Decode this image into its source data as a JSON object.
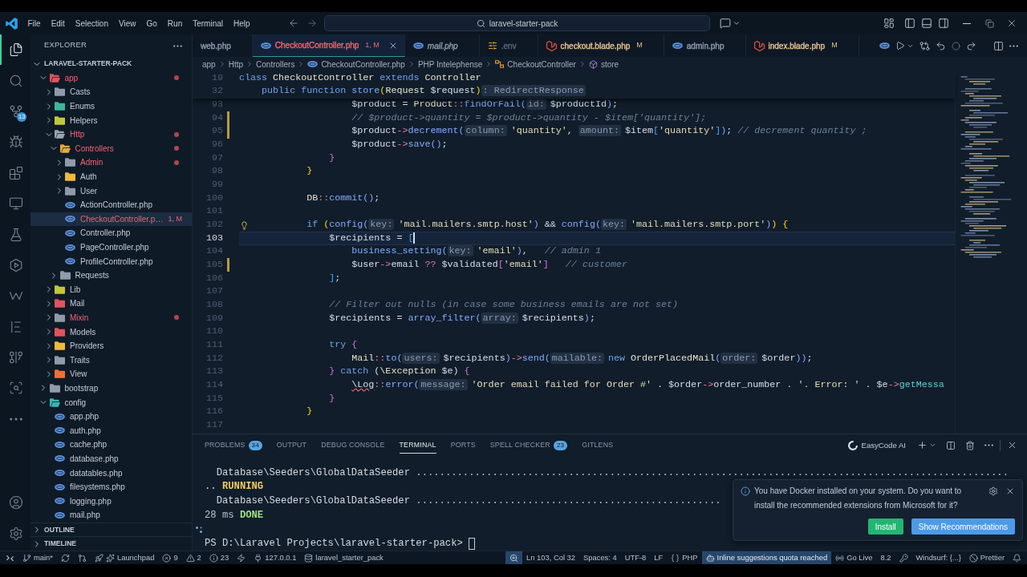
{
  "title_bar": {
    "menu": [
      "File",
      "Edit",
      "Selection",
      "View",
      "Go",
      "Run",
      "Terminal",
      "Help"
    ],
    "command_center": "laravel-starter-pack"
  },
  "activity_bar": {
    "items": [
      {
        "kind": "explorer",
        "selected": true
      },
      {
        "kind": "search",
        "selected": false
      },
      {
        "kind": "source_control",
        "selected": false,
        "badge": "13"
      },
      {
        "kind": "run_debug",
        "selected": false
      },
      {
        "kind": "extensions",
        "selected": false
      },
      {
        "kind": "remote",
        "selected": false
      },
      {
        "kind": "testing",
        "selected": false
      },
      {
        "kind": "hexagon",
        "selected": false
      },
      {
        "kind": "zigzag",
        "selected": false
      },
      {
        "kind": "bar_lines",
        "selected": false
      },
      {
        "kind": "git_graph",
        "selected": false
      },
      {
        "kind": "git_search",
        "selected": false
      },
      {
        "kind": "more",
        "selected": false
      }
    ],
    "bottom_items": [
      {
        "kind": "account"
      },
      {
        "kind": "settings"
      }
    ]
  },
  "sidebar": {
    "title": "EXPLORER",
    "sections": [
      {
        "title": "LARAVEL-STARTER-PACK",
        "expanded": true,
        "tree": [
          {
            "name": "app",
            "kind": "folder",
            "color": "#e0545c",
            "expanded": true,
            "selected": false,
            "problems": true,
            "children": [
              {
                "name": "Casts",
                "kind": "folder",
                "color": "#8f9bab",
                "expanded": false,
                "selected": false,
                "problems": false
              },
              {
                "name": "Enums",
                "kind": "folder",
                "color": "#3bb59c",
                "expanded": false,
                "selected": false,
                "problems": false
              },
              {
                "name": "Helpers",
                "kind": "folder",
                "color": "#c2c83c",
                "expanded": false,
                "selected": false,
                "problems": false
              },
              {
                "name": "Http",
                "kind": "folder",
                "color": "#9aa5b2",
                "expanded": true,
                "selected": false,
                "problems": true,
                "children": [
                  {
                    "name": "Controllers",
                    "kind": "folder",
                    "color": "#e5a93b",
                    "expanded": true,
                    "selected": false,
                    "problems": true,
                    "children": [
                      {
                        "name": "Admin",
                        "kind": "folder",
                        "color": "#8f9bab",
                        "expanded": false,
                        "selected": false,
                        "problems": true
                      },
                      {
                        "name": "Auth",
                        "kind": "folder",
                        "color": "#efb93d",
                        "expanded": false,
                        "selected": false,
                        "problems": false
                      },
                      {
                        "name": "User",
                        "kind": "folder",
                        "color": "#8f9bab",
                        "expanded": false,
                        "selected": false,
                        "problems": false
                      },
                      {
                        "name": "ActionController.php",
                        "kind": "file",
                        "selected": false,
                        "problems": false
                      },
                      {
                        "name": "CheckoutController.p…",
                        "kind": "file",
                        "selected": true,
                        "problems": true,
                        "badge": "1, M"
                      },
                      {
                        "name": "Controller.php",
                        "kind": "file",
                        "selected": false,
                        "problems": false
                      },
                      {
                        "name": "PageController.php",
                        "kind": "file",
                        "selected": false,
                        "problems": false
                      },
                      {
                        "name": "ProfileController.php",
                        "kind": "file",
                        "selected": false,
                        "problems": false
                      }
                    ]
                  },
                  {
                    "name": "Requests",
                    "kind": "folder",
                    "color": "#8f9bab",
                    "expanded": false,
                    "selected": false,
                    "problems": false
                  }
                ]
              },
              {
                "name": "Lib",
                "kind": "folder",
                "color": "#c2c83c",
                "expanded": false,
                "selected": false,
                "problems": false
              },
              {
                "name": "Mail",
                "kind": "folder",
                "color": "#e0545c",
                "expanded": false,
                "selected": false,
                "problems": false
              },
              {
                "name": "Mixin",
                "kind": "folder",
                "color": "#8f9bab",
                "expanded": false,
                "selected": false,
                "problems": true
              },
              {
                "name": "Models",
                "kind": "folder",
                "color": "#e0545c",
                "expanded": false,
                "selected": false,
                "problems": false
              },
              {
                "name": "Providers",
                "kind": "folder",
                "color": "#efb93d",
                "expanded": false,
                "selected": false,
                "problems": false
              },
              {
                "name": "Traits",
                "kind": "folder",
                "color": "#8f9bab",
                "expanded": false,
                "selected": false,
                "problems": false
              },
              {
                "name": "View",
                "kind": "folder",
                "color": "#ef6f3c",
                "expanded": false,
                "selected": false,
                "problems": false
              }
            ]
          },
          {
            "name": "bootstrap",
            "kind": "folder",
            "color": "#8f9bab",
            "expanded": false,
            "selected": false,
            "problems": false
          },
          {
            "name": "config",
            "kind": "folder",
            "color": "#3bb5b0",
            "expanded": true,
            "selected": false,
            "problems": false,
            "children": [
              {
                "name": "app.php",
                "kind": "file",
                "selected": false,
                "problems": false
              },
              {
                "name": "auth.php",
                "kind": "file",
                "selected": false,
                "problems": false
              },
              {
                "name": "cache.php",
                "kind": "file",
                "selected": false,
                "problems": false
              },
              {
                "name": "database.php",
                "kind": "file",
                "selected": false,
                "problems": false
              },
              {
                "name": "datatables.php",
                "kind": "file",
                "selected": false,
                "problems": false
              },
              {
                "name": "filesystems.php",
                "kind": "file",
                "selected": false,
                "problems": false
              },
              {
                "name": "logging.php",
                "kind": "file",
                "selected": false,
                "problems": false
              },
              {
                "name": "mail.php",
                "kind": "file",
                "selected": false,
                "problems": false
              }
            ]
          }
        ]
      },
      {
        "title": "OUTLINE",
        "expanded": false
      },
      {
        "title": "TIMELINE",
        "expanded": false
      }
    ]
  },
  "editor": {
    "tabs": [
      {
        "label": "web.php",
        "selected": false,
        "color": "#8d9bb0",
        "preview": false
      },
      {
        "label": "CheckoutController.php",
        "kind": "php",
        "selected": true,
        "color": "#f0646c",
        "badge": "1, M",
        "preview": false
      },
      {
        "label": "mail.php",
        "kind": "php",
        "selected": false,
        "color": "#8d9bb0",
        "preview": true
      },
      {
        "label": ".env",
        "kind": "env",
        "selected": false,
        "color": "#56657a",
        "preview": false
      },
      {
        "label": "checkout.blade.php",
        "kind": "blade",
        "selected": false,
        "color": "#e2c08d",
        "badge": "M",
        "preview": false
      },
      {
        "label": "admin.php",
        "kind": "php",
        "selected": false,
        "color": "#8d9bb0",
        "preview": false
      },
      {
        "label": "index.blade.php",
        "kind": "blade",
        "selected": false,
        "color": "#e2c08d",
        "badge": "M",
        "preview": false
      }
    ],
    "breadcrumb": [
      {
        "label": "app"
      },
      {
        "label": "Http"
      },
      {
        "label": "Controllers"
      },
      {
        "label": "CheckoutController.php",
        "kind": "php"
      },
      {
        "label": "PHP Intelephense"
      },
      {
        "label": "CheckoutController",
        "kind": "class"
      },
      {
        "label": "store",
        "kind": "method"
      }
    ],
    "sticky_lines": [
      {
        "number": "19",
        "tokens": [
          {
            "kind": "kw",
            "text": "class "
          },
          {
            "kind": "cls",
            "text": "CheckoutController "
          },
          {
            "kind": "kw",
            "text": "extends "
          },
          {
            "kind": "cls",
            "text": "Controller"
          }
        ]
      },
      {
        "number": "32",
        "tokens": [
          {
            "kind": "kw",
            "text": "    public function "
          },
          {
            "kind": "fn",
            "text": "store"
          },
          {
            "kind": "br1",
            "text": "("
          },
          {
            "kind": "cls",
            "text": "Request "
          },
          {
            "kind": "var",
            "text": "$request"
          },
          {
            "kind": "br1",
            "text": ")"
          },
          {
            "kind": "hint",
            "text": ": RedirectResponse"
          }
        ]
      }
    ],
    "lines": [
      {
        "number": "93",
        "current": false,
        "modified": false,
        "lightbulb": false,
        "tokens": [
          {
            "kind": "var",
            "text": "                    $product"
          },
          {
            "kind": "plain",
            "text": " = "
          },
          {
            "kind": "cls",
            "text": "Product"
          },
          {
            "kind": "op",
            "text": "::"
          },
          {
            "kind": "fn",
            "text": "findOrFail"
          },
          {
            "kind": "fn",
            "text": "("
          },
          {
            "kind": "hint",
            "text": "id:"
          },
          {
            "kind": "var",
            "text": "$productId"
          },
          {
            "kind": "fn",
            "text": ")"
          },
          {
            "kind": "punc",
            "text": ";"
          }
        ]
      },
      {
        "number": "94",
        "current": false,
        "modified": true,
        "lightbulb": false,
        "tokens": [
          {
            "kind": "cmt",
            "text": "                    // $product->quantity = $product->quantity - $item['quantity'];"
          }
        ]
      },
      {
        "number": "95",
        "current": false,
        "modified": true,
        "lightbulb": false,
        "tokens": [
          {
            "kind": "var",
            "text": "                    $product"
          },
          {
            "kind": "op",
            "text": "->"
          },
          {
            "kind": "fn",
            "text": "decrement("
          },
          {
            "kind": "hint",
            "text": "column:"
          },
          {
            "kind": "str",
            "text": "'quantity'"
          },
          {
            "kind": "punc",
            "text": ", "
          },
          {
            "kind": "hint",
            "text": "amount:"
          },
          {
            "kind": "var",
            "text": "$item"
          },
          {
            "kind": "br3",
            "text": "["
          },
          {
            "kind": "str",
            "text": "'quantity'"
          },
          {
            "kind": "br3",
            "text": "]"
          },
          {
            "kind": "fn",
            "text": ")"
          },
          {
            "kind": "punc",
            "text": "; "
          },
          {
            "kind": "cmt",
            "text": "// decrement quantity ;"
          }
        ]
      },
      {
        "number": "96",
        "current": false,
        "modified": false,
        "lightbulb": false,
        "tokens": [
          {
            "kind": "var",
            "text": "                    $product"
          },
          {
            "kind": "op",
            "text": "->"
          },
          {
            "kind": "fn",
            "text": "save()"
          },
          {
            "kind": "punc",
            "text": ";"
          }
        ]
      },
      {
        "number": "97",
        "current": false,
        "modified": false,
        "lightbulb": false,
        "tokens": [
          {
            "kind": "br2",
            "text": "                }"
          }
        ]
      },
      {
        "number": "98",
        "current": false,
        "modified": false,
        "lightbulb": false,
        "tokens": [
          {
            "kind": "br1",
            "text": "            }"
          }
        ]
      },
      {
        "number": "99",
        "current": false,
        "modified": false,
        "lightbulb": false
      },
      {
        "number": "100",
        "current": false,
        "modified": false,
        "lightbulb": false,
        "tokens": [
          {
            "kind": "cls",
            "text": "            DB"
          },
          {
            "kind": "op",
            "text": "::"
          },
          {
            "kind": "fn",
            "text": "commit()"
          },
          {
            "kind": "punc",
            "text": ";"
          }
        ]
      },
      {
        "number": "101",
        "current": false,
        "modified": false,
        "lightbulb": false
      },
      {
        "number": "102",
        "current": false,
        "modified": false,
        "lightbulb": true,
        "tokens": [
          {
            "kind": "kw",
            "text": "            if "
          },
          {
            "kind": "br1",
            "text": "("
          },
          {
            "kind": "fn",
            "text": "config("
          },
          {
            "kind": "hint",
            "text": "key:"
          },
          {
            "kind": "str",
            "text": "'mail.mailers.smtp.host'"
          },
          {
            "kind": "fn",
            "text": ")"
          },
          {
            "kind": "plain",
            "text": " && "
          },
          {
            "kind": "fn",
            "text": "config("
          },
          {
            "kind": "hint",
            "text": "key:"
          },
          {
            "kind": "str",
            "text": "'mail.mailers.smtp.port'"
          },
          {
            "kind": "fn",
            "text": ")"
          },
          {
            "kind": "br1",
            "text": ") {"
          }
        ]
      },
      {
        "number": "103",
        "current": true,
        "modified": false,
        "lightbulb": false,
        "tokens": [
          {
            "kind": "var",
            "text": "                $recipients"
          },
          {
            "kind": "plain",
            "text": " = "
          },
          {
            "kind": "br3",
            "text": "["
          }
        ]
      },
      {
        "number": "104",
        "current": false,
        "modified": false,
        "lightbulb": false,
        "tokens": [
          {
            "kind": "fn",
            "text": "                    business_setting("
          },
          {
            "kind": "hint",
            "text": "key:"
          },
          {
            "kind": "str",
            "text": "'email'"
          },
          {
            "kind": "fn",
            "text": ")"
          },
          {
            "kind": "punc",
            "text": ",   "
          },
          {
            "kind": "cmt",
            "text": "// admin 1"
          }
        ]
      },
      {
        "number": "105",
        "current": false,
        "modified": true,
        "lightbulb": false,
        "tokens": [
          {
            "kind": "var",
            "text": "                    $user"
          },
          {
            "kind": "op",
            "text": "->"
          },
          {
            "kind": "prop",
            "text": "email "
          },
          {
            "kind": "op",
            "text": "?? "
          },
          {
            "kind": "var",
            "text": "$validated"
          },
          {
            "kind": "br2",
            "text": "["
          },
          {
            "kind": "str",
            "text": "'email'"
          },
          {
            "kind": "br2",
            "text": "]"
          },
          {
            "kind": "cmt",
            "text": "   // customer"
          }
        ]
      },
      {
        "number": "106",
        "current": false,
        "modified": false,
        "lightbulb": false,
        "tokens": [
          {
            "kind": "br3",
            "text": "                ]"
          },
          {
            "kind": "punc",
            "text": ";"
          }
        ]
      },
      {
        "number": "107",
        "current": false,
        "modified": false,
        "lightbulb": false
      },
      {
        "number": "108",
        "current": false,
        "modified": false,
        "lightbulb": false,
        "tokens": [
          {
            "kind": "cmt",
            "text": "                // Filter out nulls (in case some business emails are not set)"
          }
        ]
      },
      {
        "number": "109",
        "current": false,
        "modified": false,
        "lightbulb": false,
        "tokens": [
          {
            "kind": "var",
            "text": "                $recipients"
          },
          {
            "kind": "plain",
            "text": " = "
          },
          {
            "kind": "fn",
            "text": "array_filter("
          },
          {
            "kind": "hint",
            "text": "array:"
          },
          {
            "kind": "var",
            "text": "$recipients"
          },
          {
            "kind": "fn",
            "text": ")"
          },
          {
            "kind": "punc",
            "text": ";"
          }
        ]
      },
      {
        "number": "110",
        "current": false,
        "modified": false,
        "lightbulb": false
      },
      {
        "number": "111",
        "current": false,
        "modified": false,
        "lightbulb": false,
        "tokens": [
          {
            "kind": "kw",
            "text": "                try "
          },
          {
            "kind": "br2",
            "text": "{"
          }
        ]
      },
      {
        "number": "112",
        "current": false,
        "modified": false,
        "lightbulb": false,
        "tokens": [
          {
            "kind": "cls",
            "text": "                    Mail"
          },
          {
            "kind": "op",
            "text": "::"
          },
          {
            "kind": "fn",
            "text": "to("
          },
          {
            "kind": "hint",
            "text": "users:"
          },
          {
            "kind": "var",
            "text": "$recipients"
          },
          {
            "kind": "fn",
            "text": ")"
          },
          {
            "kind": "op",
            "text": "->"
          },
          {
            "kind": "fn",
            "text": "send("
          },
          {
            "kind": "hint",
            "text": "mailable:"
          },
          {
            "kind": "kw",
            "text": "new "
          },
          {
            "kind": "cls",
            "text": "OrderPlacedMail"
          },
          {
            "kind": "fn",
            "text": "("
          },
          {
            "kind": "hint",
            "text": "order:"
          },
          {
            "kind": "var",
            "text": "$order"
          },
          {
            "kind": "fn",
            "text": "))"
          },
          {
            "kind": "punc",
            "text": ";"
          }
        ]
      },
      {
        "number": "113",
        "current": false,
        "modified": false,
        "lightbulb": false,
        "tokens": [
          {
            "kind": "br2",
            "text": "                }"
          },
          {
            "kind": "kw",
            "text": " catch "
          },
          {
            "kind": "punc",
            "text": "("
          },
          {
            "kind": "cls",
            "text": "\\Exception "
          },
          {
            "kind": "var",
            "text": "$e"
          },
          {
            "kind": "punc",
            "text": ") "
          },
          {
            "kind": "br2",
            "text": "{"
          }
        ]
      },
      {
        "number": "114",
        "current": false,
        "modified": false,
        "lightbulb": false,
        "tokens": [
          {
            "kind": "err",
            "text": "                    \\Log"
          },
          {
            "kind": "op",
            "text": "::"
          },
          {
            "kind": "fn",
            "text": "error("
          },
          {
            "kind": "hint",
            "text": "message:"
          },
          {
            "kind": "str",
            "text": "'Order email failed for Order #'"
          },
          {
            "kind": "plain",
            "text": " . "
          },
          {
            "kind": "var",
            "text": "$order"
          },
          {
            "kind": "op",
            "text": "->"
          },
          {
            "kind": "prop",
            "text": "order_number"
          },
          {
            "kind": "plain",
            "text": " . "
          },
          {
            "kind": "str",
            "text": "'. Error: '"
          },
          {
            "kind": "plain",
            "text": " . "
          },
          {
            "kind": "var",
            "text": "$e"
          },
          {
            "kind": "op",
            "text": "->"
          },
          {
            "kind": "method",
            "text": "getMessa"
          }
        ]
      },
      {
        "number": "115",
        "current": false,
        "modified": false,
        "lightbulb": false,
        "tokens": [
          {
            "kind": "br2",
            "text": "                }"
          }
        ]
      },
      {
        "number": "116",
        "current": false,
        "modified": false,
        "lightbulb": false,
        "tokens": [
          {
            "kind": "br1",
            "text": "            }"
          }
        ]
      },
      {
        "number": "117",
        "current": false,
        "modified": false,
        "lightbulb": false
      }
    ]
  },
  "panel": {
    "tabs": [
      {
        "label": "PROBLEMS",
        "selected": false,
        "badge": "34"
      },
      {
        "label": "OUTPUT",
        "selected": false
      },
      {
        "label": "DEBUG CONSOLE",
        "selected": false
      },
      {
        "label": "TERMINAL",
        "selected": true
      },
      {
        "label": "PORTS",
        "selected": false
      },
      {
        "label": "SPELL CHECKER",
        "selected": false,
        "badge": "23"
      },
      {
        "label": "GITLENS",
        "selected": false
      }
    ],
    "terminal_name": "EasyCode AI",
    "terminal": [
      {
        "kind": "output",
        "tokens": [
          {
            "kind": "plain",
            "text": "  Database\\Seeders\\GlobalDataSeeder "
          },
          {
            "kind": "dim",
            "text": "....................................................................................................."
          }
        ]
      },
      {
        "kind": "output",
        "tokens": [
          {
            "kind": "plain",
            "text": ".. "
          },
          {
            "kind": "warn",
            "text": "RUNNING"
          }
        ]
      },
      {
        "kind": "output",
        "tokens": [
          {
            "kind": "plain",
            "text": "  Database\\Seeders\\GlobalDataSeeder "
          },
          {
            "kind": "dim",
            "text": "...................................................."
          }
        ]
      },
      {
        "kind": "output",
        "tokens": [
          {
            "kind": "dim",
            "text": "28 ms "
          },
          {
            "kind": "ok",
            "text": "DONE"
          }
        ]
      },
      {
        "kind": "marker"
      },
      {
        "kind": "prompt",
        "tokens": [
          {
            "kind": "plain",
            "text": "PS D:\\Laravel Projects\\laravel-starter-pack>"
          }
        ]
      }
    ]
  },
  "notification": {
    "message": "You have Docker installed on your system. Do you want to install the recommended extensions from Microsoft for it?",
    "buttons": [
      {
        "label": "Install",
        "color": "#22b573"
      },
      {
        "label": "Show Recommendations",
        "color": "#4c9be8"
      }
    ]
  },
  "status_bar": {
    "left": [
      {
        "kind": "remote"
      },
      {
        "kind": "branch",
        "label": "main*"
      },
      {
        "kind": "sync"
      },
      {
        "kind": "git"
      },
      {
        "kind": "launchpad",
        "label": "Launchpad"
      },
      {
        "kind": "errors",
        "label": "9"
      },
      {
        "kind": "warnings",
        "label": "2"
      },
      {
        "kind": "infos",
        "label": "23"
      },
      {
        "kind": "lightning"
      },
      {
        "kind": "server",
        "label": "127.0.0.1"
      },
      {
        "kind": "database",
        "label": "laravel_starter_pack"
      }
    ],
    "right": [
      {
        "kind": "zoom",
        "highlighted": true
      },
      {
        "kind": "text",
        "label": "Ln 103, Col 32",
        "highlighted": false
      },
      {
        "kind": "text",
        "label": "Spaces: 4",
        "highlighted": false
      },
      {
        "kind": "text",
        "label": "UTF-8",
        "highlighted": false
      },
      {
        "kind": "text",
        "label": "LF",
        "highlighted": false
      },
      {
        "kind": "language",
        "label": "PHP",
        "highlighted": false
      },
      {
        "kind": "copilot",
        "label": "Inline suggestions quota reached",
        "highlighted": true
      },
      {
        "kind": "live",
        "label": "Go Live",
        "highlighted": false
      },
      {
        "kind": "text",
        "label": "8.2",
        "highlighted": false
      },
      {
        "kind": "key",
        "highlighted": false
      },
      {
        "kind": "text",
        "label": "Windsurf: {...}",
        "highlighted": false
      },
      {
        "kind": "prettier",
        "label": "Prettier",
        "highlighted": false
      },
      {
        "kind": "bell",
        "highlighted": false
      }
    ]
  }
}
